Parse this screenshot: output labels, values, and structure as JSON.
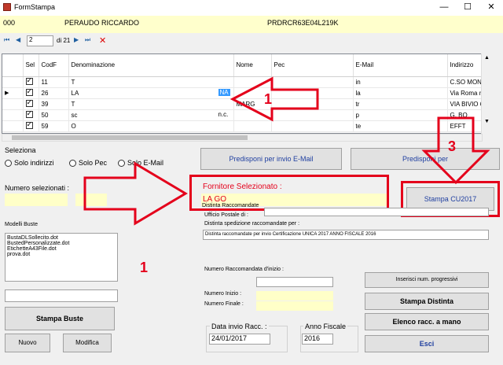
{
  "window": {
    "title": "FormStampa",
    "controls": [
      "—",
      "☐",
      "✕"
    ]
  },
  "header": {
    "code": "000",
    "name": "PERAUDO RICCARDO",
    "fiscal_code": "PRDRCR63E04L219K"
  },
  "nav": {
    "page_value": "2",
    "page_of": "di 21"
  },
  "grid": {
    "columns": [
      "Sel",
      "CodF",
      "Denominazione",
      "Nome",
      "Pec",
      "E-Mail",
      "Indirizzo"
    ],
    "rows": [
      {
        "checked": true,
        "codf": "11",
        "den": "T",
        "nome": "",
        "pec": "",
        "email": "in",
        "indirizzo": "C.SO MONT",
        "current": false
      },
      {
        "checked": true,
        "codf": "26",
        "den": "LA",
        "den_tail": "NA",
        "nome": "",
        "pec": "",
        "email": "la",
        "indirizzo": "Via Roma n.",
        "current": true
      },
      {
        "checked": true,
        "codf": "39",
        "den": "T",
        "nome": "MARG",
        "pec": "",
        "email": "tr",
        "indirizzo": "VIA BIVIO 6,",
        "current": false
      },
      {
        "checked": true,
        "codf": "50",
        "den": "sc",
        "den_tail": "n.c.",
        "nome": "",
        "pec": "",
        "email": "p",
        "indirizzo": "G. BO",
        "current": false
      },
      {
        "checked": true,
        "codf": "59",
        "den": "O",
        "nome": "",
        "pec": "",
        "email": "te",
        "indirizzo": "EFFT",
        "current": false
      }
    ]
  },
  "seleziona": {
    "label": "Seleziona",
    "options": [
      "Solo indirizzi",
      "Solo Pec",
      "Solo E-Mail"
    ]
  },
  "buttons": {
    "email": "Predisponi per invio E-Mail",
    "pec": "Predisponi per",
    "cu": "Stampa CU2017",
    "stampa_buste": "Stampa Buste",
    "nuovo": "Nuovo",
    "modifica": "Modifica",
    "progressivi": "Inserisci num. progressivi",
    "distinta": "Stampa Distinta",
    "elenco": "Elenco racc. a mano",
    "esci": "Esci"
  },
  "numero_selezionati": {
    "label": "Numero selezionati :"
  },
  "fornitore": {
    "label": "Fornitore Selezionato :",
    "value": "LA GO"
  },
  "modelli": {
    "label": "Modelli Buste",
    "items": [
      "BustaDLSollecito.dot",
      "BustedPersonalizzate.dot",
      "EtichetteA43File.dot",
      "prova.dot"
    ]
  },
  "distinta": {
    "label": "Distinta Raccomandate",
    "ufficio_label": "Ufficio Postale di :",
    "spedizione_label": "Distinta spedizione raccomandate per :",
    "spedizione_value": "Distinta raccomandate per invio Certificazione UNICA 2017 ANNO FISCALE 2016",
    "numero_label": "Numero Raccomandata d'inizio :",
    "inizio_label": "Numero Inizio :",
    "finale_label": "Numero Finale :"
  },
  "data_invio": {
    "label": "Data  invio Racc. :",
    "value": "24/01/2017"
  },
  "anno_fiscale": {
    "label": "Anno Fiscale",
    "value": "2016"
  },
  "annotations": {
    "num1": "1",
    "num1b": "1",
    "num3": "3"
  },
  "colors": {
    "annotation_red": "#e4001b",
    "field_yellow": "#ffffc8"
  }
}
